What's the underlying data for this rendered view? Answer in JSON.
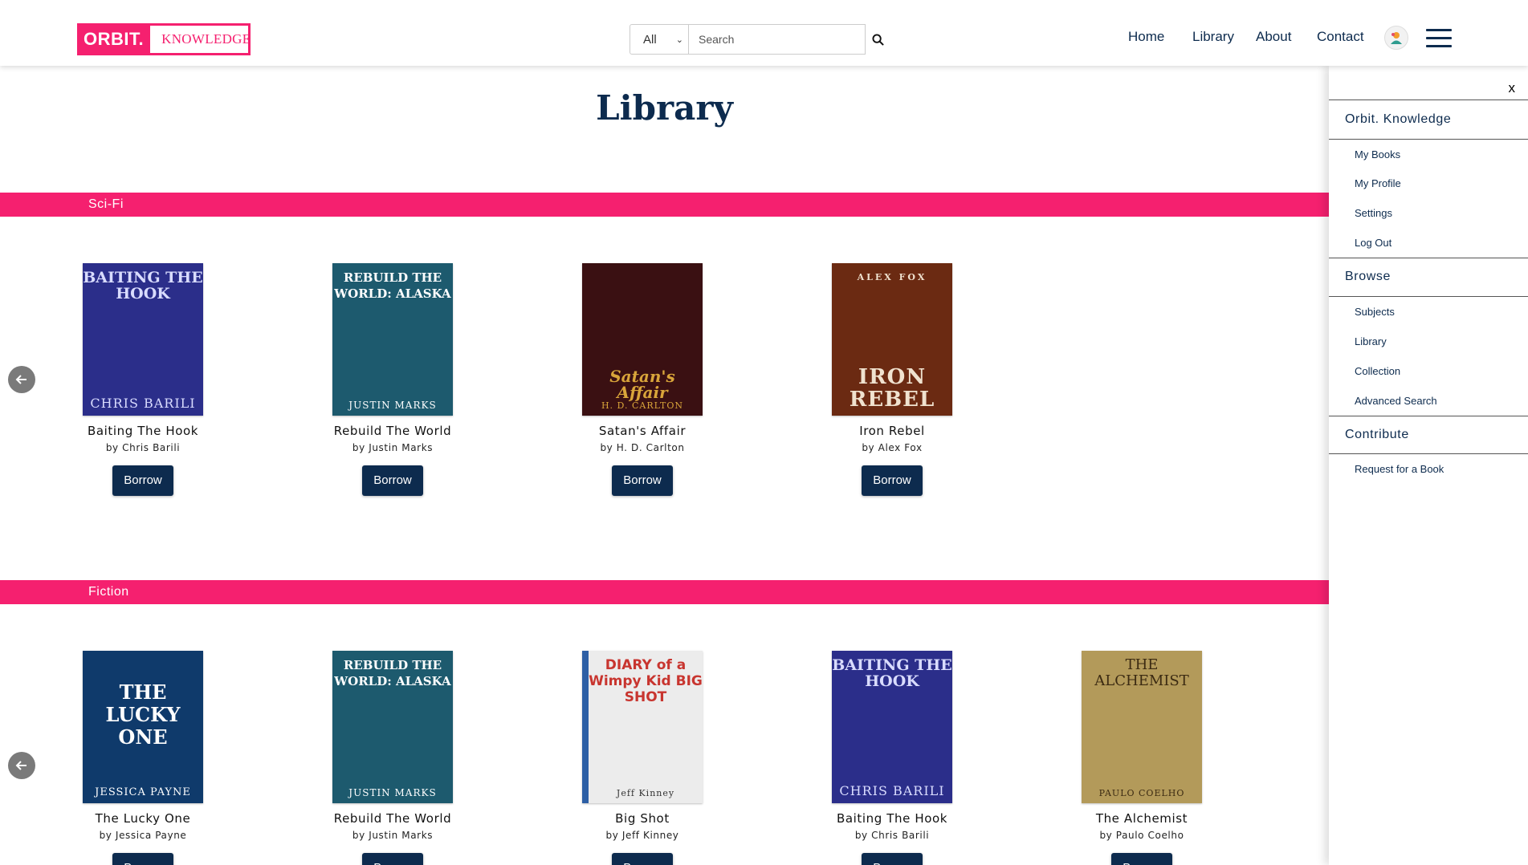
{
  "header": {
    "logo_primary": "ORBIT.",
    "logo_secondary": "KNOWLEDGE",
    "search_scope": "All",
    "search_placeholder": "Search",
    "nav": [
      "Home",
      "Library",
      "About",
      "Contact"
    ],
    "icons": {
      "search": "magnifier-icon",
      "avatar": "user-avatar-icon",
      "menu": "hamburger-menu-icon"
    }
  },
  "main": {
    "title": "Library",
    "borrow_label": "Borrow",
    "sections": [
      {
        "name": "Sci-Fi",
        "books": [
          {
            "title": "Baiting The Hook",
            "author": "by Chris Barili",
            "cover_top": "BAITING THE HOOK",
            "cover_bottom": "CHRIS BARILI",
            "bg": "#2b2e8a",
            "fg": "#d9dcff"
          },
          {
            "title": "Rebuild The World",
            "author": "by Justin Marks",
            "cover_top": "REBUILD THE WORLD: ALASKA",
            "cover_bottom": "JUSTIN MARKS",
            "bg": "#1d5a6e",
            "fg": "#ffffff"
          },
          {
            "title": "Satan's Affair",
            "author": "by H. D. Carlton",
            "cover_top": "Satan's Affair",
            "cover_bottom": "H. D. CARLTON",
            "bg": "#3a1012",
            "fg": "#d9a53a"
          },
          {
            "title": "Iron Rebel",
            "author": "by Alex Fox",
            "cover_top": "ALEX FOX",
            "cover_bottom": "IRON REBEL",
            "bg": "#6b2a12",
            "fg": "#f0e2cf"
          }
        ]
      },
      {
        "name": "Fiction",
        "books": [
          {
            "title": "The Lucky One",
            "author": "by Jessica Payne",
            "cover_top": "THE LUCKY ONE",
            "cover_bottom": "JESSICA PAYNE",
            "bg": "#0f3a6b",
            "fg": "#ffffff"
          },
          {
            "title": "Rebuild The World",
            "author": "by Justin Marks",
            "cover_top": "REBUILD THE WORLD: ALASKA",
            "cover_bottom": "JUSTIN MARKS",
            "bg": "#1d5a6e",
            "fg": "#ffffff"
          },
          {
            "title": "Big Shot",
            "author": "by Jeff Kinney",
            "cover_top": "DIARY of a Wimpy Kid BIG SHOT",
            "cover_bottom": "Jeff Kinney",
            "bg": "#ececec",
            "fg": "#c8352f"
          },
          {
            "title": "Baiting The Hook",
            "author": "by Chris Barili",
            "cover_top": "BAITING THE HOOK",
            "cover_bottom": "CHRIS BARILI",
            "bg": "#2b2e8a",
            "fg": "#d9dcff"
          },
          {
            "title": "The Alchemist",
            "author": "by Paulo Coelho",
            "cover_top": "THE ALCHEMIST",
            "cover_bottom": "PAULO COELHO",
            "bg": "#b39a5a",
            "fg": "#3b2a12"
          }
        ]
      }
    ]
  },
  "sidebar": {
    "close": "x",
    "groups": [
      {
        "heading": "Orbit. Knowledge",
        "items": [
          "My Books",
          "My Profile",
          "Settings",
          "Log Out"
        ]
      },
      {
        "heading": "Browse",
        "items": [
          "Subjects",
          "Library",
          "Collection",
          "Advanced Search"
        ]
      },
      {
        "heading": "Contribute",
        "items": [
          "Request for a Book"
        ]
      }
    ]
  },
  "colors": {
    "accent": "#f5206f",
    "navy": "#0d2b4e"
  }
}
